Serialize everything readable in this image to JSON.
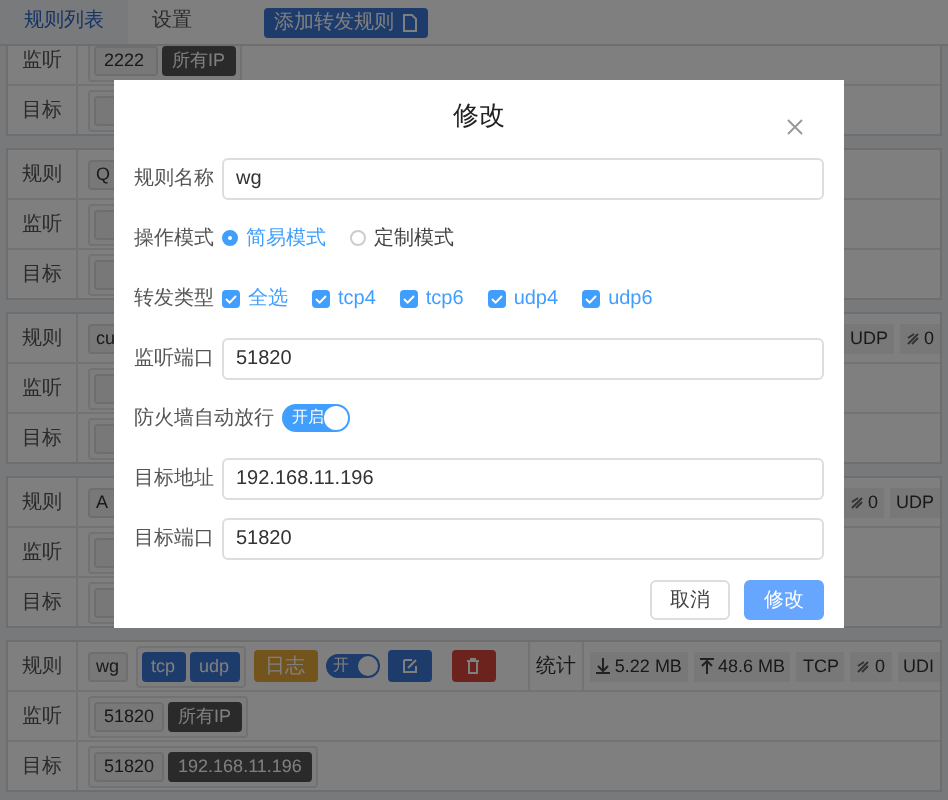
{
  "tabs": [
    {
      "label": "规则列表",
      "selected": true
    },
    {
      "label": "设置",
      "selected": false
    }
  ],
  "add_button": "添加转发规则",
  "rules": [
    {
      "rows": [
        {
          "label": "监听",
          "chips": [
            {
              "kind": "port",
              "text": "2222"
            },
            {
              "kind": "ip",
              "text": "所有IP"
            }
          ]
        },
        {
          "label": "目标",
          "chips": [
            {
              "kind": "port"
            }
          ]
        }
      ]
    },
    {
      "rows": [
        {
          "label": "规则",
          "chips": [
            {
              "kind": "name",
              "text": "Q"
            }
          ]
        },
        {
          "label": "监听",
          "chips": [
            {
              "kind": "port"
            }
          ]
        },
        {
          "label": "目标",
          "chips": [
            {
              "kind": "port"
            }
          ]
        }
      ]
    },
    {
      "rows": [
        {
          "label": "规则",
          "chips": [
            {
              "kind": "name",
              "text": "cu"
            }
          ],
          "stats": [
            {
              "kind": "proto",
              "text": "UDP"
            },
            {
              "kind": "conn",
              "text": "0"
            }
          ]
        },
        {
          "label": "监听",
          "chips": [
            {
              "kind": "port"
            }
          ]
        },
        {
          "label": "目标",
          "chips": [
            {
              "kind": "port"
            }
          ]
        }
      ]
    },
    {
      "rows": [
        {
          "label": "规则",
          "chips": [
            {
              "kind": "name",
              "text": "A"
            }
          ],
          "stats": [
            {
              "kind": "conn",
              "text": "0"
            },
            {
              "kind": "proto",
              "text": "UDP"
            }
          ]
        },
        {
          "label": "监听",
          "chips": [
            {
              "kind": "port"
            }
          ]
        },
        {
          "label": "目标",
          "chips": [
            {
              "kind": "port"
            }
          ]
        }
      ]
    },
    {
      "rows": [
        {
          "label": "规则",
          "chips": [
            {
              "kind": "name",
              "text": "wg"
            }
          ],
          "protocols": [
            "tcp",
            "udp"
          ],
          "log": "日志",
          "enabled": {
            "on": true,
            "text": "开"
          },
          "stats_label": "统计",
          "stats": [
            {
              "kind": "download",
              "text": "5.22 MB"
            },
            {
              "kind": "upload",
              "text": "48.6 MB"
            },
            {
              "kind": "proto",
              "text": "TCP"
            },
            {
              "kind": "conn",
              "text": "0"
            },
            {
              "kind": "proto",
              "text": "UDI"
            }
          ]
        },
        {
          "label": "监听",
          "chips": [
            {
              "kind": "port",
              "text": "51820"
            },
            {
              "kind": "ip",
              "text": "所有IP"
            }
          ]
        },
        {
          "label": "目标",
          "chips": [
            {
              "kind": "port",
              "text": "51820"
            },
            {
              "kind": "ip",
              "text": "192.168.11.196"
            }
          ]
        }
      ]
    }
  ],
  "dialog": {
    "title": "修改",
    "fields": [
      {
        "kind": "text",
        "label": "规则名称",
        "value": "wg"
      },
      {
        "kind": "radio",
        "label": "操作模式",
        "options": [
          {
            "label": "简易模式",
            "selected": true
          },
          {
            "label": "定制模式",
            "selected": false
          }
        ]
      },
      {
        "kind": "checkbox",
        "label": "转发类型",
        "options": [
          {
            "label": "全选",
            "checked": true
          },
          {
            "label": "tcp4",
            "checked": true
          },
          {
            "label": "tcp6",
            "checked": true
          },
          {
            "label": "udp4",
            "checked": true
          },
          {
            "label": "udp6",
            "checked": true
          }
        ]
      },
      {
        "kind": "text",
        "label": "监听端口",
        "value": "51820"
      },
      {
        "kind": "switch",
        "label": "防火墙自动放行",
        "on": true,
        "text": "开启"
      },
      {
        "kind": "text",
        "label": "目标地址",
        "value": "192.168.11.196"
      },
      {
        "kind": "text",
        "label": "目标端口",
        "value": "51820"
      }
    ],
    "buttons": [
      {
        "kind": "default",
        "label": "取消"
      },
      {
        "kind": "primary",
        "label": "修改"
      }
    ]
  }
}
